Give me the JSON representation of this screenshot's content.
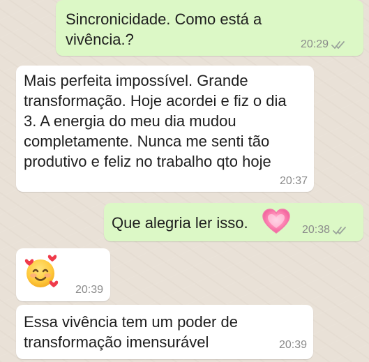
{
  "theme": {
    "sent_bubble_color": "#dcf8c6",
    "received_bubble_color": "#ffffff",
    "check_color": "#9aa39b"
  },
  "messages": [
    {
      "direction": "sent",
      "text": "Sincronicidade. Como está a vivência.?",
      "time": "20:29",
      "status_icon": "double-check-icon"
    },
    {
      "direction": "received",
      "text": "Mais perfeita impossível. Grande transformação. Hoje acordei e fiz o dia 3. A energia do meu dia mudou completamente. Nunca me senti tão produtivo e feliz no trabalho qto hoje",
      "time": "20:37"
    },
    {
      "direction": "sent",
      "text": "Que alegria ler isso.",
      "emoji": "growing-heart-icon",
      "time": "20:38",
      "status_icon": "double-check-icon"
    },
    {
      "direction": "received",
      "emoji": "smiling-face-with-hearts-icon",
      "time": "20:39"
    },
    {
      "direction": "received",
      "text": "Essa vivência tem um poder de transformação imensurável",
      "time": "20:39"
    }
  ]
}
